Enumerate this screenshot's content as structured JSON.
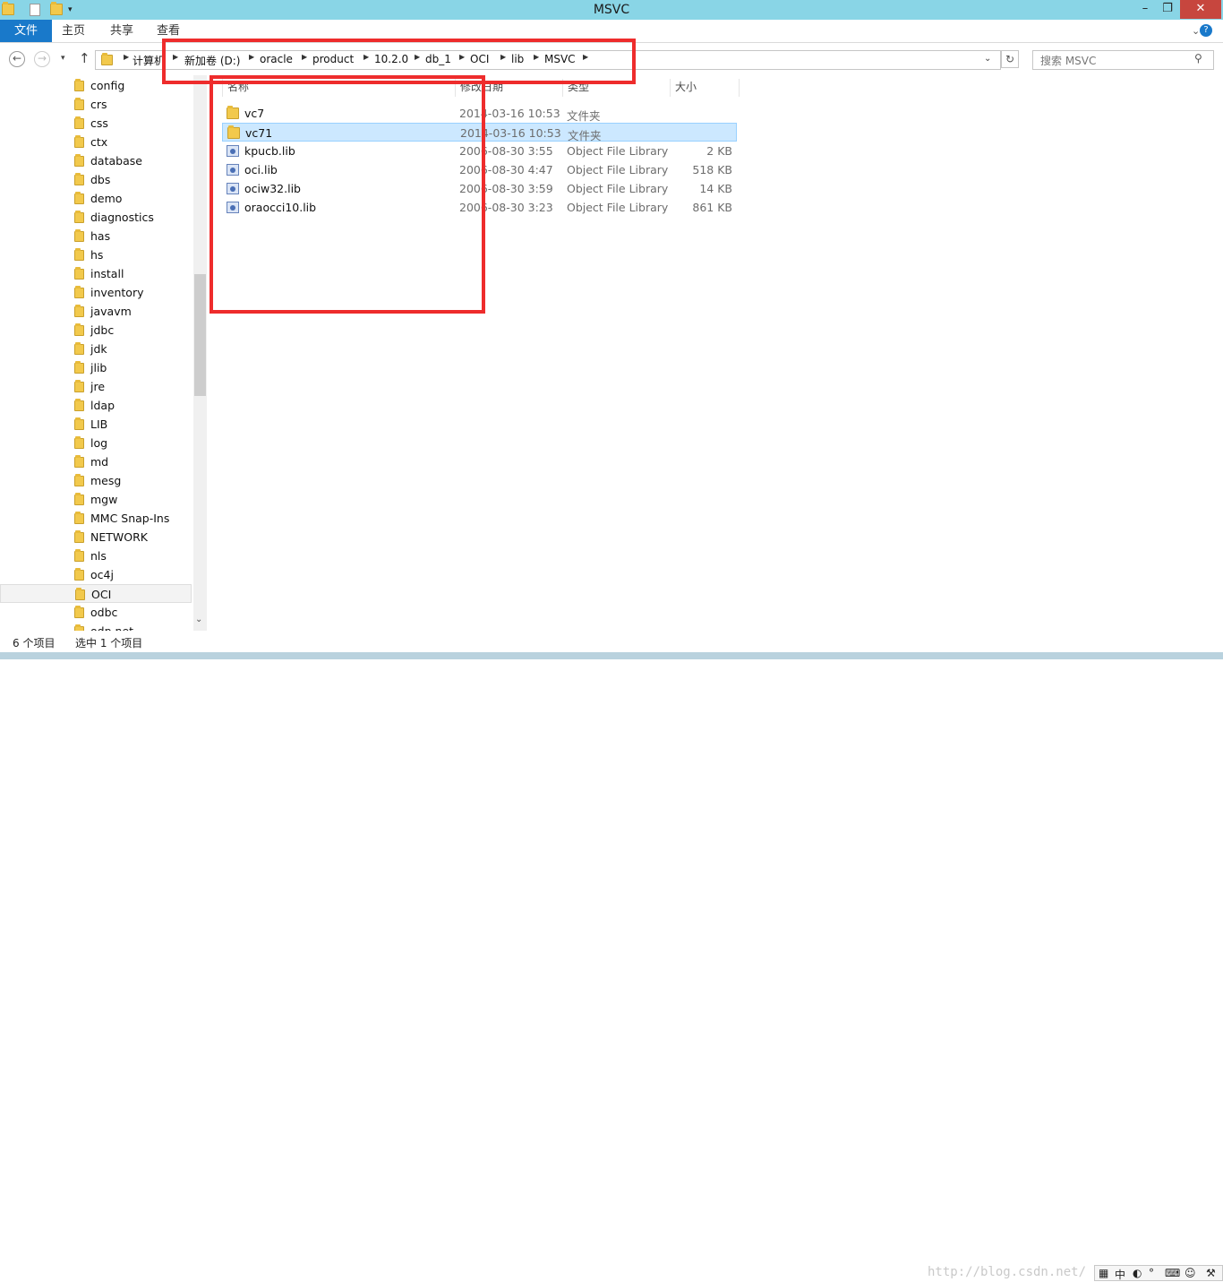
{
  "window": {
    "title": "MSVC"
  },
  "ribbon": {
    "tabs": [
      "文件",
      "主页",
      "共享",
      "查看"
    ]
  },
  "address": {
    "crumbs": [
      "计算机",
      "新加卷 (D:)",
      "oracle",
      "product",
      "10.2.0",
      "db_1",
      "OCI",
      "lib",
      "MSVC"
    ]
  },
  "search": {
    "placeholder": "搜索 MSVC"
  },
  "nav": {
    "items": [
      "config",
      "crs",
      "css",
      "ctx",
      "database",
      "dbs",
      "demo",
      "diagnostics",
      "has",
      "hs",
      "install",
      "inventory",
      "javavm",
      "jdbc",
      "jdk",
      "jlib",
      "jre",
      "ldap",
      "LIB",
      "log",
      "md",
      "mesg",
      "mgw",
      "MMC Snap-Ins",
      "NETWORK",
      "nls",
      "oc4j",
      "OCI",
      "odbc",
      "odp.net"
    ],
    "selected": "OCI"
  },
  "columns": {
    "name": "名称",
    "date": "修改日期",
    "type": "类型",
    "size": "大小"
  },
  "files": [
    {
      "name": "vc7",
      "date": "2014-03-16 10:53",
      "type": "文件夹",
      "size": "",
      "kind": "folder"
    },
    {
      "name": "vc71",
      "date": "2014-03-16 10:53",
      "type": "文件夹",
      "size": "",
      "kind": "folder",
      "selected": true
    },
    {
      "name": "kpucb.lib",
      "date": "2006-08-30 3:55",
      "type": "Object File Library",
      "size": "2 KB",
      "kind": "lib"
    },
    {
      "name": "oci.lib",
      "date": "2006-08-30 4:47",
      "type": "Object File Library",
      "size": "518 KB",
      "kind": "lib"
    },
    {
      "name": "ociw32.lib",
      "date": "2006-08-30 3:59",
      "type": "Object File Library",
      "size": "14 KB",
      "kind": "lib"
    },
    {
      "name": "oraocci10.lib",
      "date": "2006-08-30 3:23",
      "type": "Object File Library",
      "size": "861 KB",
      "kind": "lib"
    }
  ],
  "status": {
    "count": "6 个项目",
    "selection": "选中 1 个项目"
  },
  "watermark": "http://blog.csdn.net/",
  "ime": {
    "lang": "中"
  },
  "colors": {
    "titlebar": "#89d5e6",
    "accent": "#1979ca",
    "highlight": "#ee2c2c",
    "selection": "#cce8ff"
  }
}
